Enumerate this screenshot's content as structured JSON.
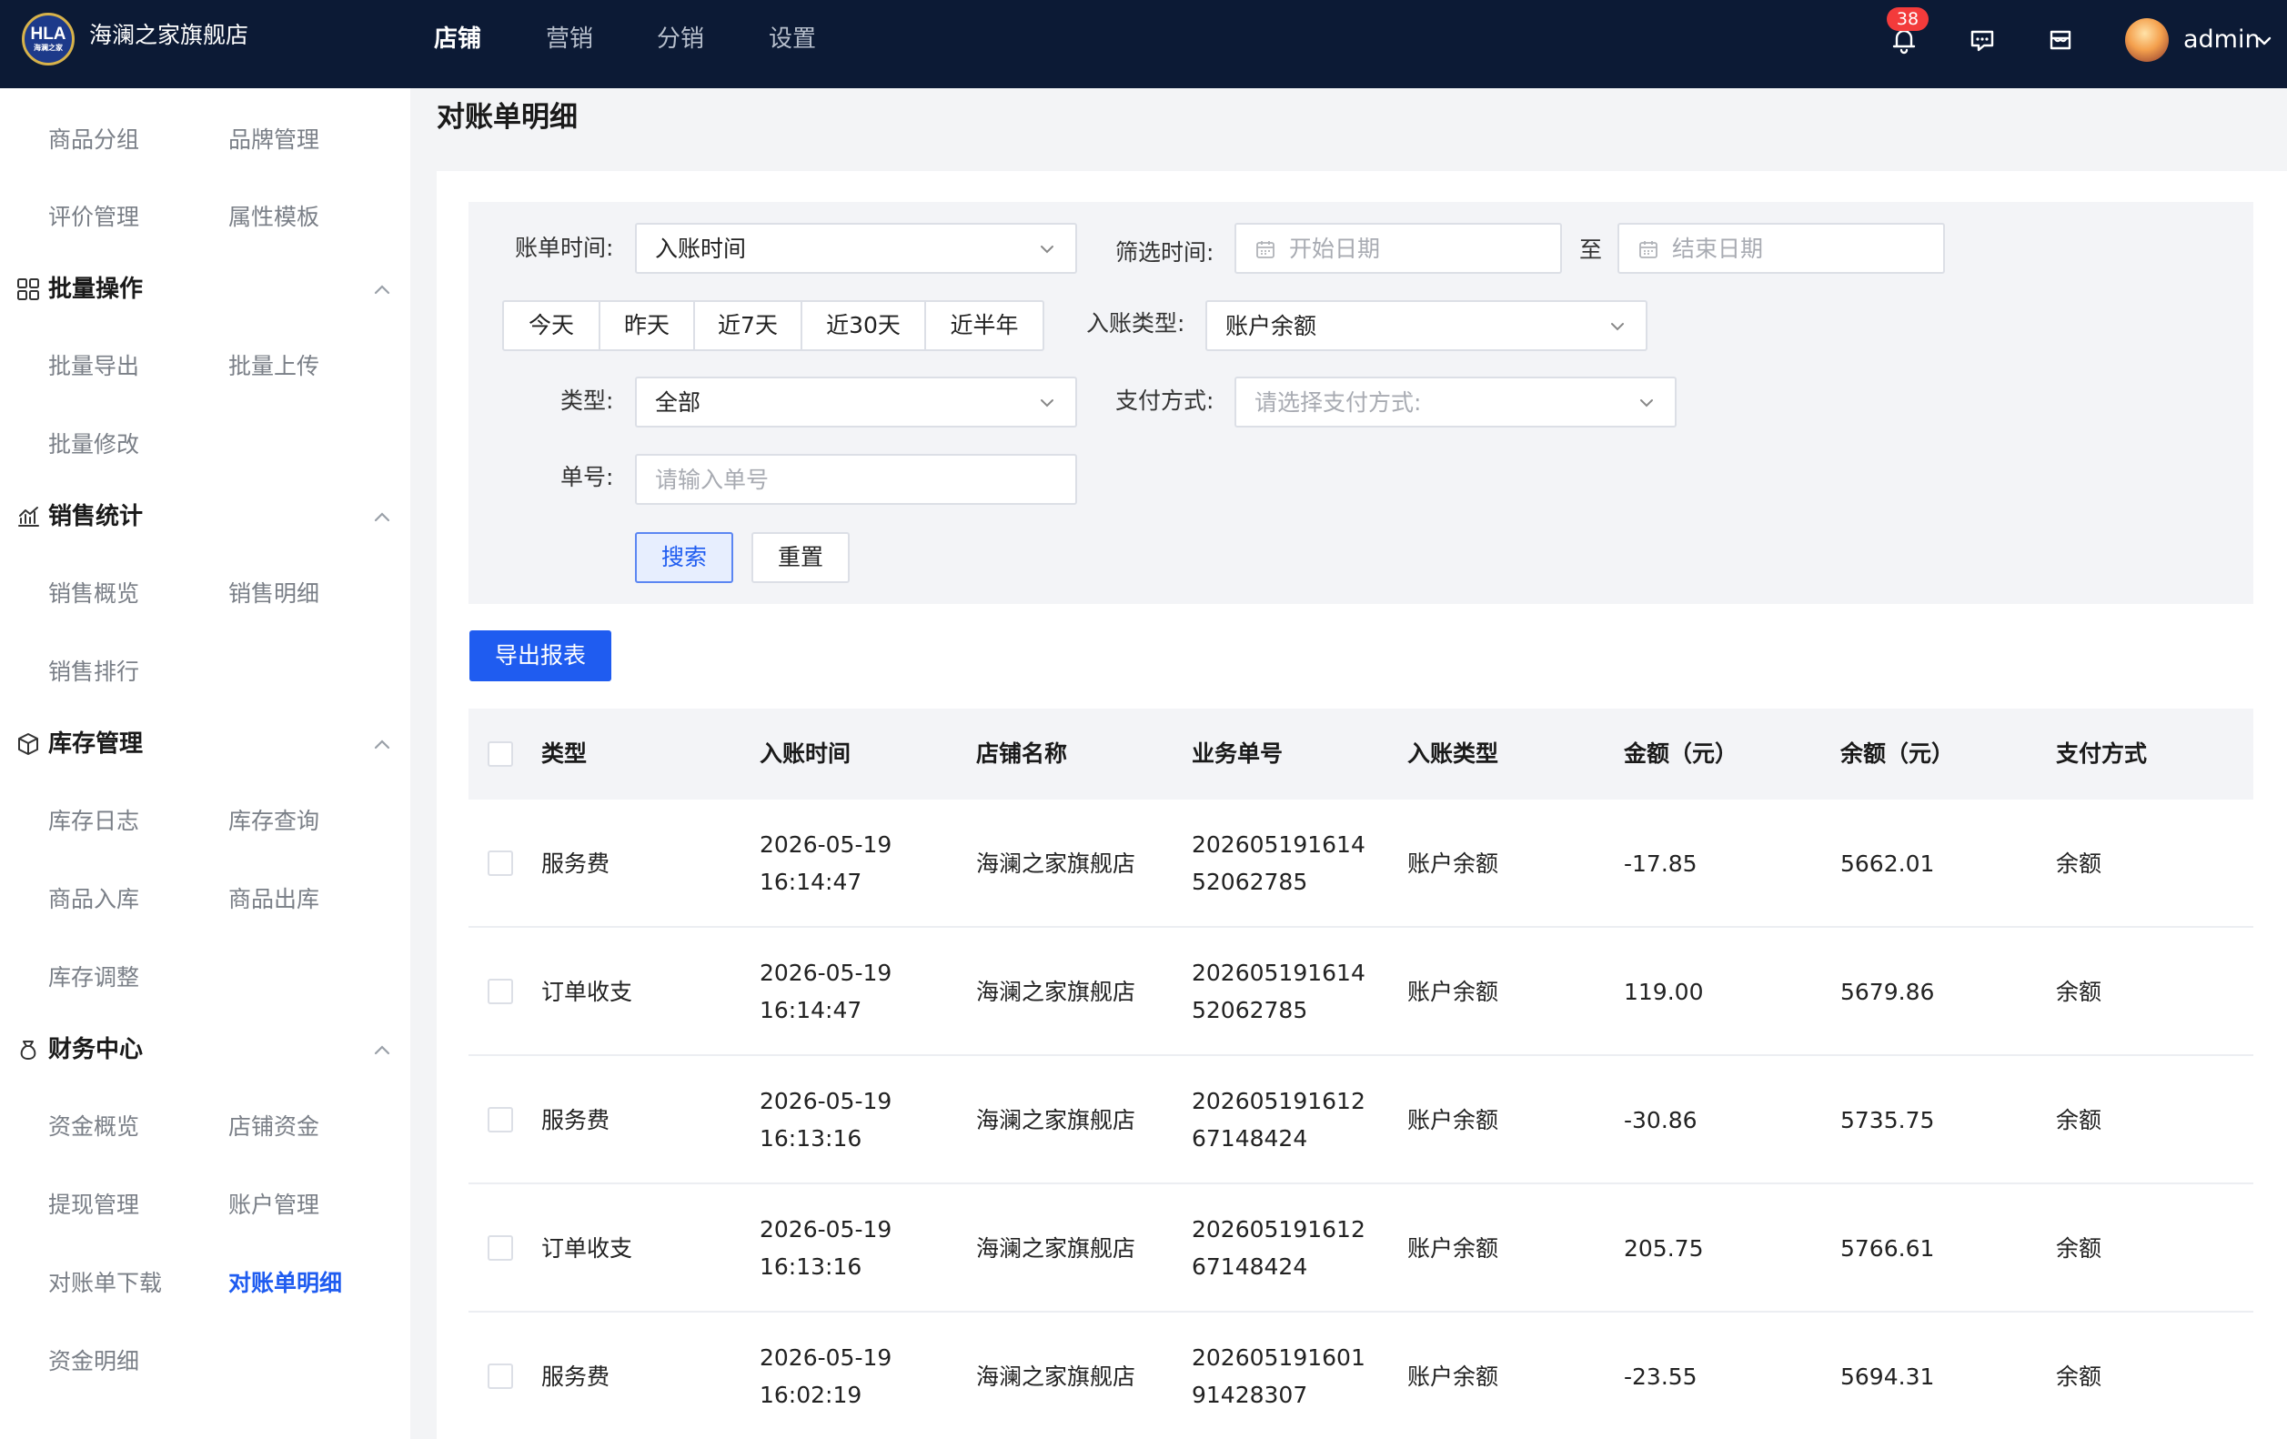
{
  "header": {
    "logo_text": "HLA",
    "logo_subtext": "海澜之家",
    "shop_name": "海澜之家旗舰店",
    "nav": [
      "店铺",
      "营销",
      "分销",
      "设置"
    ],
    "active_nav": "店铺",
    "notification_count": "38",
    "username": "admin",
    "icons": [
      "bell-icon",
      "message-icon",
      "store-icon",
      "chevron-down-icon"
    ]
  },
  "sidebar": {
    "top_links": [
      "商品分组",
      "品牌管理",
      "评价管理",
      "属性模板"
    ],
    "groups": [
      {
        "title": "批量操作",
        "icon": "grid-icon",
        "links": [
          "批量导出",
          "批量上传",
          "批量修改"
        ]
      },
      {
        "title": "销售统计",
        "icon": "trend-chart-icon",
        "links": [
          "销售概览",
          "销售明细",
          "销售排行"
        ]
      },
      {
        "title": "库存管理",
        "icon": "box-icon",
        "links": [
          "库存日志",
          "库存查询",
          "商品入库",
          "商品出库",
          "库存调整"
        ]
      },
      {
        "title": "财务中心",
        "icon": "money-bag-icon",
        "links": [
          "资金概览",
          "店铺资金",
          "提现管理",
          "账户管理",
          "对账单下载",
          "对账单明细",
          "资金明细"
        ]
      }
    ],
    "active_link": "对账单明细"
  },
  "page": {
    "title": "对账单明细"
  },
  "filters": {
    "bill_time_label": "账单时间:",
    "bill_time_value": "入账时间",
    "filter_time_label": "筛选时间:",
    "start_placeholder": "开始日期",
    "to_label": "至",
    "end_placeholder": "结束日期",
    "quick_ranges": [
      "今天",
      "昨天",
      "近7天",
      "近30天",
      "近半年"
    ],
    "entry_type_label": "入账类型:",
    "entry_type_value": "账户余额",
    "type_label": "类型:",
    "type_value": "全部",
    "pay_method_label": "支付方式:",
    "pay_method_placeholder": "请选择支付方式:",
    "order_no_label": "单号:",
    "order_no_placeholder": "请输入单号",
    "search_button": "搜索",
    "reset_button": "重置"
  },
  "export_button": "导出报表",
  "table": {
    "columns": [
      "类型",
      "入账时间",
      "店铺名称",
      "业务单号",
      "入账类型",
      "金额（元）",
      "余额（元）",
      "支付方式"
    ],
    "rows": [
      {
        "type": "服务费",
        "date": "2026-05-19",
        "time": "16:14:47",
        "shop": "海澜之家旗舰店",
        "no1": "202605191614",
        "no2": "52062785",
        "entry_type": "账户余额",
        "amount": "-17.85",
        "balance": "5662.01",
        "pay": "余额"
      },
      {
        "type": "订单收支",
        "date": "2026-05-19",
        "time": "16:14:47",
        "shop": "海澜之家旗舰店",
        "no1": "202605191614",
        "no2": "52062785",
        "entry_type": "账户余额",
        "amount": "119.00",
        "balance": "5679.86",
        "pay": "余额"
      },
      {
        "type": "服务费",
        "date": "2026-05-19",
        "time": "16:13:16",
        "shop": "海澜之家旗舰店",
        "no1": "202605191612",
        "no2": "67148424",
        "entry_type": "账户余额",
        "amount": "-30.86",
        "balance": "5735.75",
        "pay": "余额"
      },
      {
        "type": "订单收支",
        "date": "2026-05-19",
        "time": "16:13:16",
        "shop": "海澜之家旗舰店",
        "no1": "202605191612",
        "no2": "67148424",
        "entry_type": "账户余额",
        "amount": "205.75",
        "balance": "5766.61",
        "pay": "余额"
      },
      {
        "type": "服务费",
        "date": "2026-05-19",
        "time": "16:02:19",
        "shop": "海澜之家旗舰店",
        "no1": "202605191601",
        "no2": "91428307",
        "entry_type": "账户余额",
        "amount": "-23.55",
        "balance": "5694.31",
        "pay": "余额"
      }
    ]
  },
  "colors": {
    "header_bg": "#0c1a35",
    "accent": "#1f5cf0",
    "badge": "#f33b3b",
    "filter_bg": "#f3f4f7"
  }
}
